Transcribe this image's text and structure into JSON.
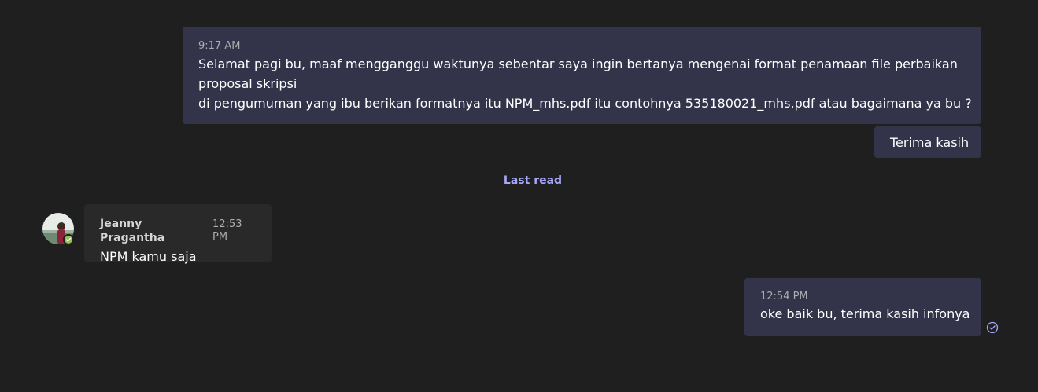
{
  "messages": {
    "m1": {
      "time": "9:17 AM",
      "lines": [
        "Selamat pagi bu, maaf mengganggu waktunya sebentar saya ingin bertanya mengenai format penamaan file perbaikan",
        "proposal skripsi",
        "di pengumuman yang ibu berikan formatnya itu NPM_mhs.pdf itu contohnya 535180021_mhs.pdf atau bagaimana ya bu ?"
      ]
    },
    "m2": {
      "text": "Terima kasih"
    },
    "divider": {
      "label": "Last read"
    },
    "m3": {
      "sender": "Jeanny Pragantha",
      "time": "12:53 PM",
      "text": "NPM kamu saja"
    },
    "m4": {
      "time": "12:54 PM",
      "text": "oke baik bu, terima kasih infonya"
    }
  },
  "icons": {
    "presence": "available-check-icon",
    "read_receipt": "read-receipt-check-icon"
  },
  "colors": {
    "background": "#1f1f1f",
    "outgoing_bubble": "#33344a",
    "incoming_bubble": "#292929",
    "accent": "#7f85f5",
    "presence_available": "#92c353"
  }
}
